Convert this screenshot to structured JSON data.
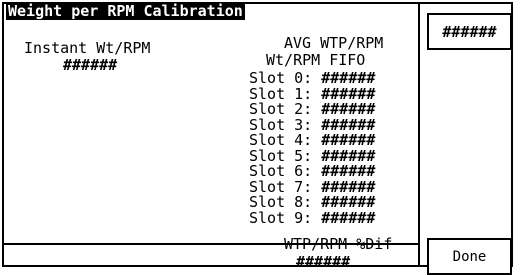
{
  "title": "Weight per RPM Calibration",
  "readout_value": "######",
  "instant": {
    "label": "Instant Wt/RPM",
    "value": "######"
  },
  "avg_label": "AVG WTP/RPM",
  "fifo_label": "Wt/RPM FIFO",
  "slots": [
    {
      "label": "Slot 0:",
      "value": "######"
    },
    {
      "label": "Slot 1:",
      "value": "######"
    },
    {
      "label": "Slot 2:",
      "value": "######"
    },
    {
      "label": "Slot 3:",
      "value": "######"
    },
    {
      "label": "Slot 4:",
      "value": "######"
    },
    {
      "label": "Slot 5:",
      "value": "######"
    },
    {
      "label": "Slot 6:",
      "value": "######"
    },
    {
      "label": "Slot 7:",
      "value": "######"
    },
    {
      "label": "Slot 8:",
      "value": "######"
    },
    {
      "label": "Slot 9:",
      "value": "######"
    }
  ],
  "dif": {
    "label": "WTP/RPM %Dif",
    "value": "######"
  },
  "done_label": "Done"
}
